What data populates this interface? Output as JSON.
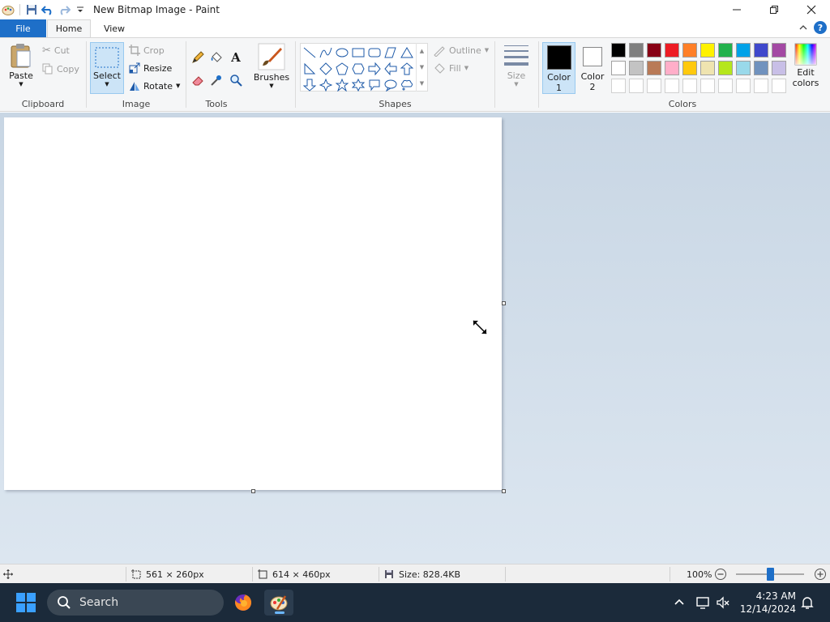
{
  "window": {
    "title": "New Bitmap Image - Paint"
  },
  "tabs": {
    "file": "File",
    "home": "Home",
    "view": "View"
  },
  "ribbon": {
    "clipboard": {
      "label": "Clipboard",
      "paste": "Paste",
      "cut": "Cut",
      "copy": "Copy"
    },
    "image": {
      "label": "Image",
      "select": "Select",
      "crop": "Crop",
      "resize": "Resize",
      "rotate": "Rotate"
    },
    "tools": {
      "label": "Tools"
    },
    "brushes": {
      "label": "Brushes"
    },
    "shapes": {
      "label": "Shapes",
      "outline": "Outline",
      "fill": "Fill"
    },
    "size": {
      "label": "Size"
    },
    "colors": {
      "label": "Colors",
      "color1_line1": "Color",
      "color1_line2": "1",
      "color2_line1": "Color",
      "color2_line2": "2",
      "edit_line1": "Edit",
      "edit_line2": "colors",
      "color1_value": "#000000",
      "color2_value": "#ffffff",
      "palette_row1": [
        "#000000",
        "#7f7f7f",
        "#880015",
        "#ed1c24",
        "#ff7f27",
        "#fff200",
        "#22b14c",
        "#00a2e8",
        "#3f48cc",
        "#a349a4"
      ],
      "palette_row2": [
        "#ffffff",
        "#c3c3c3",
        "#b97a57",
        "#ffaec9",
        "#ffc90e",
        "#efe4b0",
        "#b5e61d",
        "#99d9ea",
        "#7092be",
        "#c8bfe7"
      ]
    }
  },
  "statusbar": {
    "selection_size": "561 × 260px",
    "image_size": "614 × 460px",
    "file_size": "Size: 828.4KB",
    "zoom": "100%"
  },
  "taskbar": {
    "search_placeholder": "Search",
    "time": "4:23 AM",
    "date": "12/14/2024"
  }
}
